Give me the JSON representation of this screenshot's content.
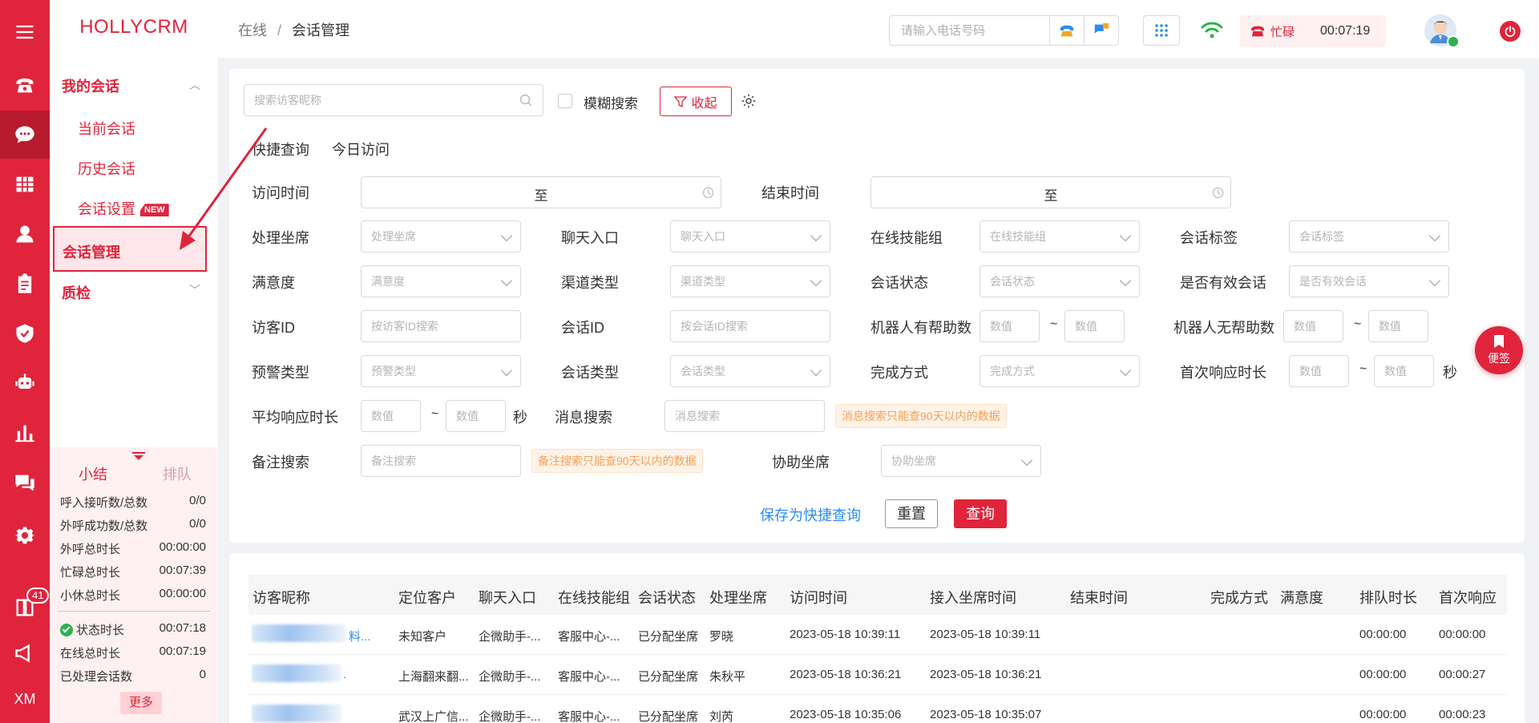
{
  "app": {
    "brand": "HOLLYCRM"
  },
  "colors": {
    "accent": "#e0243b",
    "link": "#2d8cf0",
    "hint_text": "#f5a057"
  },
  "rail": {
    "icons": [
      "menu-icon",
      "phone-icon",
      "chat-icon",
      "grid-icon",
      "user-icon",
      "clipboard-icon",
      "shield-icon",
      "robot-icon",
      "bar-chart-icon",
      "comments-icon",
      "gear-icon",
      "book-icon",
      "megaphone-icon"
    ],
    "badge_count": "41",
    "bottom_text": "XM"
  },
  "sidebar": {
    "group1": "我的会话",
    "items": [
      "当前会话",
      "历史会话",
      "会话设置"
    ],
    "new_tag": "NEW",
    "active": "会话管理",
    "group2": "质检"
  },
  "stats": {
    "tab_summary": "小结",
    "tab_queue": "排队",
    "rows": [
      {
        "label": "呼入接听数/总数",
        "value": "0/0"
      },
      {
        "label": "外呼成功数/总数",
        "value": "0/0"
      },
      {
        "label": "外呼总时长",
        "value": "00:00:00"
      },
      {
        "label": "忙碌总时长",
        "value": "00:07:39"
      },
      {
        "label": "小休总时长",
        "value": "00:00:00"
      },
      {
        "label": "状态时长",
        "value": "00:07:18"
      },
      {
        "label": "在线总时长",
        "value": "00:07:19"
      },
      {
        "label": "已处理会话数",
        "value": "0"
      }
    ],
    "more": "更多"
  },
  "header": {
    "breadcrumb_root": "在线",
    "breadcrumb_sep": "/",
    "breadcrumb_current": "会话管理",
    "phone_placeholder": "请输入电话号码",
    "status_label": "忙碌",
    "status_timer": "00:07:19"
  },
  "filters": {
    "search_placeholder": "搜索访客昵称",
    "fuzzy_label": "模糊搜索",
    "collapse_label": "收起",
    "quick_query": "快捷查询",
    "today_visit": "今日访问",
    "visit_time": "访问时间",
    "end_time": "结束时间",
    "range_sep": "至",
    "tilde": "~",
    "seconds": "秒",
    "row2": [
      {
        "label": "处理坐席",
        "placeholder": "处理坐席"
      },
      {
        "label": "聊天入口",
        "placeholder": "聊天入口"
      },
      {
        "label": "在线技能组",
        "placeholder": "在线技能组"
      },
      {
        "label": "会话标签",
        "placeholder": "会话标签"
      }
    ],
    "row3": [
      {
        "label": "满意度",
        "placeholder": "满意度"
      },
      {
        "label": "渠道类型",
        "placeholder": "渠道类型"
      },
      {
        "label": "会话状态",
        "placeholder": "会话状态"
      },
      {
        "label": "是否有效会话",
        "placeholder": "是否有效会话"
      }
    ],
    "visitor_id": {
      "label": "访客ID",
      "placeholder": "按访客ID搜索"
    },
    "session_id": {
      "label": "会话ID",
      "placeholder": "按会话ID搜索"
    },
    "robot_helpful": "机器人有帮助数",
    "robot_unhelpful": "机器人无帮助数",
    "number_placeholder": "数值",
    "alert_type": {
      "label": "预警类型",
      "placeholder": "预警类型"
    },
    "session_type": {
      "label": "会话类型",
      "placeholder": "会话类型"
    },
    "finish_mode": {
      "label": "完成方式",
      "placeholder": "完成方式"
    },
    "first_response": "首次响应时长",
    "avg_response": "平均响应时长",
    "message_search": {
      "label": "消息搜索",
      "placeholder": "消息搜索"
    },
    "message_hint": "消息搜索只能查90天以内的数据",
    "remark_search": {
      "label": "备注搜索",
      "placeholder": "备注搜索"
    },
    "remark_hint": "备注搜索只能查90天以内的数据",
    "assist_agent": {
      "label": "协助坐席",
      "placeholder": "协助坐席"
    },
    "save_quick": "保存为快捷查询",
    "reset": "重置",
    "query": "查询"
  },
  "table": {
    "columns": [
      "访客昵称",
      "定位客户",
      "聊天入口",
      "在线技能组",
      "会话状态",
      "处理坐席",
      "访问时间",
      "接入坐席时间",
      "结束时间",
      "完成方式",
      "满意度",
      "排队时长",
      "首次响应"
    ],
    "rows": [
      {
        "nickname_tail": "料...",
        "customer": "未知客户",
        "entry": "企微助手-...",
        "skill": "客服中心-...",
        "state": "已分配坐席",
        "agent": "罗晓",
        "visit": "2023-05-18 10:39:11",
        "connect": "2023-05-18 10:39:11",
        "end": "",
        "finish": "",
        "satisfaction": "",
        "queue": "00:00:00",
        "first": "00:00:00"
      },
      {
        "nickname_tail": ".",
        "customer": "上海翻来翻...",
        "entry": "企微助手-...",
        "skill": "客服中心-...",
        "state": "已分配坐席",
        "agent": "朱秋平",
        "visit": "2023-05-18 10:36:21",
        "connect": "2023-05-18 10:36:21",
        "end": "",
        "finish": "",
        "satisfaction": "",
        "queue": "00:00:00",
        "first": "00:00:27"
      },
      {
        "nickname_tail": "",
        "customer": "武汉上广信...",
        "entry": "企微助手-...",
        "skill": "客服中心-...",
        "state": "已分配坐席",
        "agent": "刘芮",
        "visit": "2023-05-18 10:35:06",
        "connect": "2023-05-18 10:35:07",
        "end": "",
        "finish": "",
        "satisfaction": "",
        "queue": "00:00:00",
        "first": "00:00:23"
      }
    ]
  },
  "note_button": "便签"
}
